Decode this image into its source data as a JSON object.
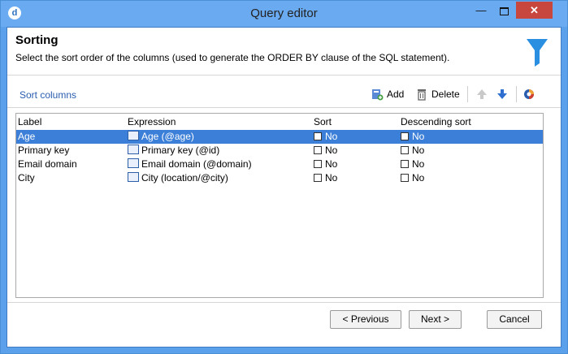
{
  "window": {
    "title": "Query editor",
    "app_icon": "d"
  },
  "header": {
    "title": "Sorting",
    "subtitle": "Select the sort order of the columns (used to generate the ORDER BY clause of the SQL statement)."
  },
  "toolbar": {
    "section_label": "Sort columns",
    "add_label": "Add",
    "delete_label": "Delete"
  },
  "grid": {
    "columns": [
      "Label",
      "Expression",
      "Sort",
      "Descending sort"
    ],
    "rows": [
      {
        "label": "Age",
        "expression": "Age (@age)",
        "sort": "No",
        "descending": "No",
        "selected": true
      },
      {
        "label": "Primary key",
        "expression": "Primary key (@id)",
        "sort": "No",
        "descending": "No"
      },
      {
        "label": "Email domain",
        "expression": "Email domain (@domain)",
        "sort": "No",
        "descending": "No"
      },
      {
        "label": "City",
        "expression": "City (location/@city)",
        "sort": "No",
        "descending": "No"
      }
    ]
  },
  "footer": {
    "previous_label": "< Previous",
    "next_label": "Next >",
    "cancel_label": "Cancel"
  },
  "colors": {
    "titlebar": "#6aaaf0",
    "selection": "#3b7fd8",
    "close": "#c7463d",
    "accent": "#2a5db0"
  }
}
